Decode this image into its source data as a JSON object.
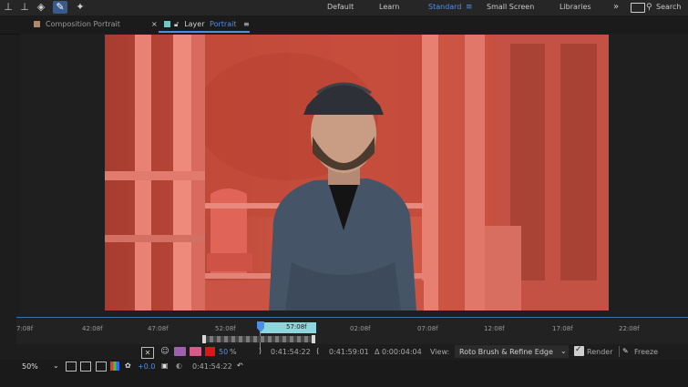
{
  "workspaces": [
    "Default",
    "Learn",
    "Standard",
    "Small Screen",
    "Libraries"
  ],
  "search": {
    "label": "Search"
  },
  "tabs": {
    "composition": "Composition Portrait",
    "layer_prefix": "Layer",
    "layer_name": "Portrait"
  },
  "timeline": {
    "ticks": [
      "7:08f",
      "42:08f",
      "47:08f",
      "52:08f",
      "57:08f",
      "02:08f",
      "07:08f",
      "12:08f",
      "17:08f",
      "22:08f"
    ],
    "current": "57:08f"
  },
  "controls": {
    "zoom_pct": "50",
    "pct_sign": "%",
    "time_in": "0:41:54:22",
    "time_out": "0:41:59:01",
    "duration": "Δ 0:00:04:04",
    "view_label": "View:",
    "view_value": "Roto Brush & Refine Edge",
    "render_label": "Render",
    "freeze_label": "Freeze",
    "magnification": "50%",
    "exposure": "+0.0",
    "current_time": "0:41:54:22"
  },
  "colors": {
    "accent": "#4d8fe8",
    "overlay": "#e14a3c",
    "timeline_span": "#8ed6dc"
  }
}
